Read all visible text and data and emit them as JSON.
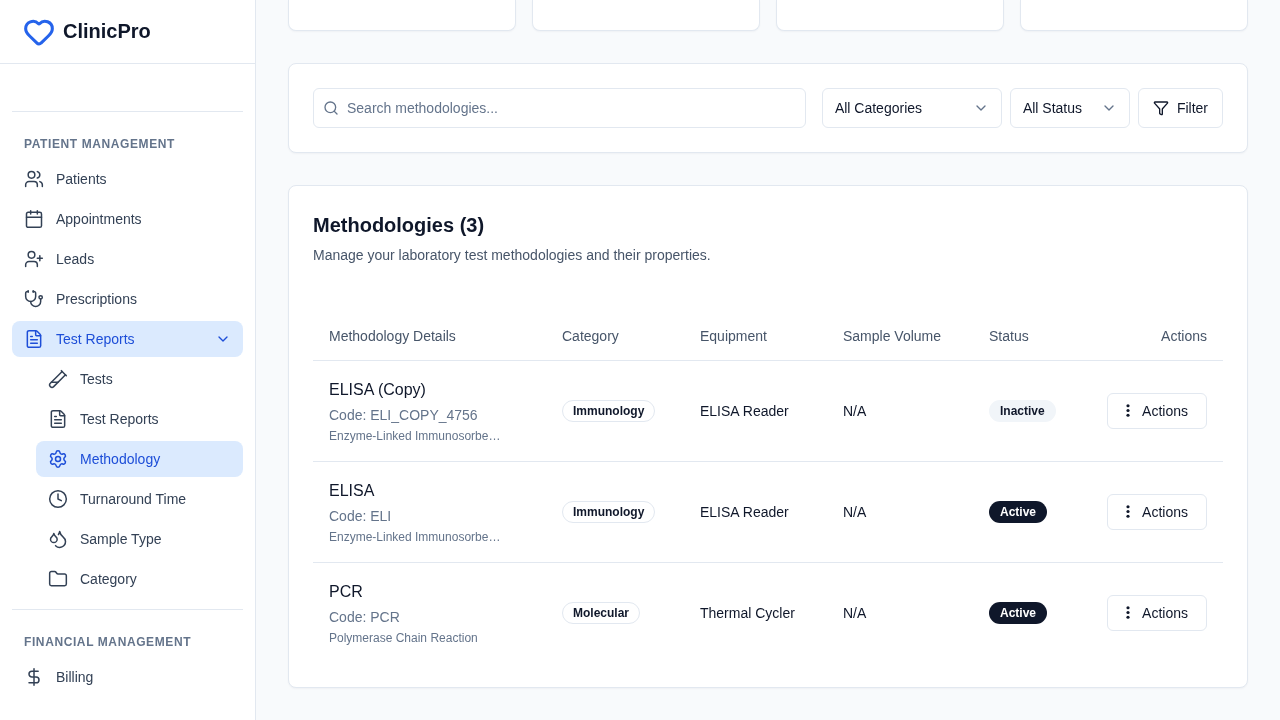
{
  "sidebar": {
    "brand": "ClinicPro",
    "sections": [
      {
        "heading": "PATIENT MANAGEMENT",
        "items": [
          {
            "label": "Patients",
            "selected": false,
            "expanded": false
          },
          {
            "label": "Appointments",
            "selected": false,
            "expanded": false
          },
          {
            "label": "Leads",
            "selected": false,
            "expanded": false
          },
          {
            "label": "Prescriptions",
            "selected": false,
            "expanded": false
          },
          {
            "label": "Test Reports",
            "selected": true,
            "expanded": true,
            "children": [
              {
                "label": "Tests",
                "selected": false
              },
              {
                "label": "Test Reports",
                "selected": false
              },
              {
                "label": "Methodology",
                "selected": true
              },
              {
                "label": "Turnaround Time",
                "selected": false
              },
              {
                "label": "Sample Type",
                "selected": false
              },
              {
                "label": "Category",
                "selected": false
              }
            ]
          }
        ]
      },
      {
        "heading": "FINANCIAL MANAGEMENT",
        "items": [
          {
            "label": "Billing",
            "selected": false,
            "expanded": false
          }
        ]
      }
    ]
  },
  "filters": {
    "search": {
      "placeholder": "Search methodologies..."
    },
    "category_select": {
      "value": "All Categories"
    },
    "status_select": {
      "value": "All Status"
    },
    "filter_button": "Filter"
  },
  "methodologies": {
    "title": "Methodologies (3)",
    "description": "Manage your laboratory test methodologies and their properties.",
    "table": {
      "columns": [
        "Methodology Details",
        "Category",
        "Equipment",
        "Sample Volume",
        "Status",
        "Actions"
      ],
      "rows": [
        {
          "name": "ELISA (Copy)",
          "code": "Code: ELI_COPY_4756",
          "description": "Enzyme-Linked Immunosorbe…",
          "category": "Immunology",
          "equipment": "ELISA Reader",
          "sample_volume": "N/A",
          "status": "Inactive",
          "active": false,
          "action": "Actions"
        },
        {
          "name": "ELISA",
          "code": "Code: ELI",
          "description": "Enzyme-Linked Immunosorbe…",
          "category": "Immunology",
          "equipment": "ELISA Reader",
          "sample_volume": "N/A",
          "status": "Active",
          "active": true,
          "action": "Actions"
        },
        {
          "name": "PCR",
          "code": "Code: PCR",
          "description": "Polymerase Chain Reaction",
          "category": "Molecular",
          "equipment": "Thermal Cycler",
          "sample_volume": "N/A",
          "status": "Active",
          "active": true,
          "action": "Actions"
        }
      ]
    }
  }
}
